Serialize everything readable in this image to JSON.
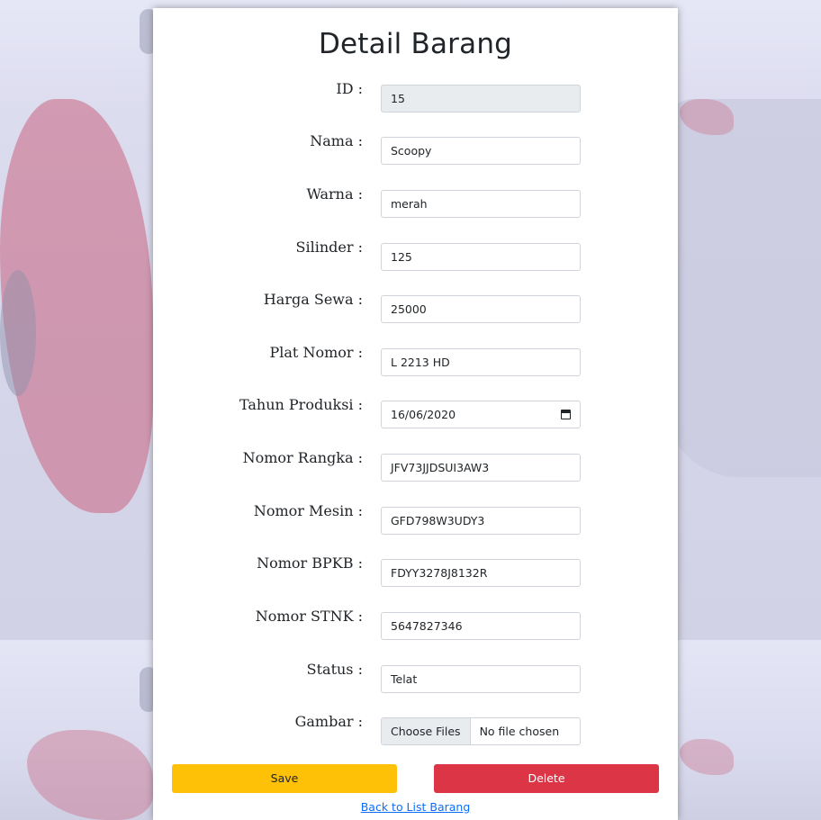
{
  "page": {
    "title": "Detail Barang",
    "back_link": "Back to List Barang"
  },
  "form": {
    "fields": [
      {
        "label": "ID :",
        "value": "15",
        "readonly": true
      },
      {
        "label": "Nama :",
        "value": "Scoopy"
      },
      {
        "label": "Warna :",
        "value": "merah"
      },
      {
        "label": "Silinder :",
        "value": "125"
      },
      {
        "label": "Harga Sewa :",
        "value": "25000"
      },
      {
        "label": "Plat Nomor :",
        "value": "L 2213 HD"
      },
      {
        "label": "Tahun Produksi :",
        "value": "16/06/2020",
        "type": "date",
        "icon": "calendar-icon"
      },
      {
        "label": "Nomor Rangka :",
        "value": "JFV73JJDSUI3AW3"
      },
      {
        "label": "Nomor Mesin :",
        "value": "GFD798W3UDY3"
      },
      {
        "label": "Nomor BPKB :",
        "value": "FDYY3278J8132R"
      },
      {
        "label": "Nomor STNK :",
        "value": "5647827346"
      },
      {
        "label": "Status :",
        "value": "Telat"
      }
    ],
    "gambar": {
      "label": "Gambar :",
      "button": "Choose Files",
      "status": "No file chosen"
    }
  },
  "buttons": {
    "save": "Save",
    "delete": "Delete"
  },
  "colors": {
    "save": "#ffc107",
    "delete": "#dc3545",
    "link": "#0d6efd",
    "readonly_bg": "#e9ecef"
  }
}
